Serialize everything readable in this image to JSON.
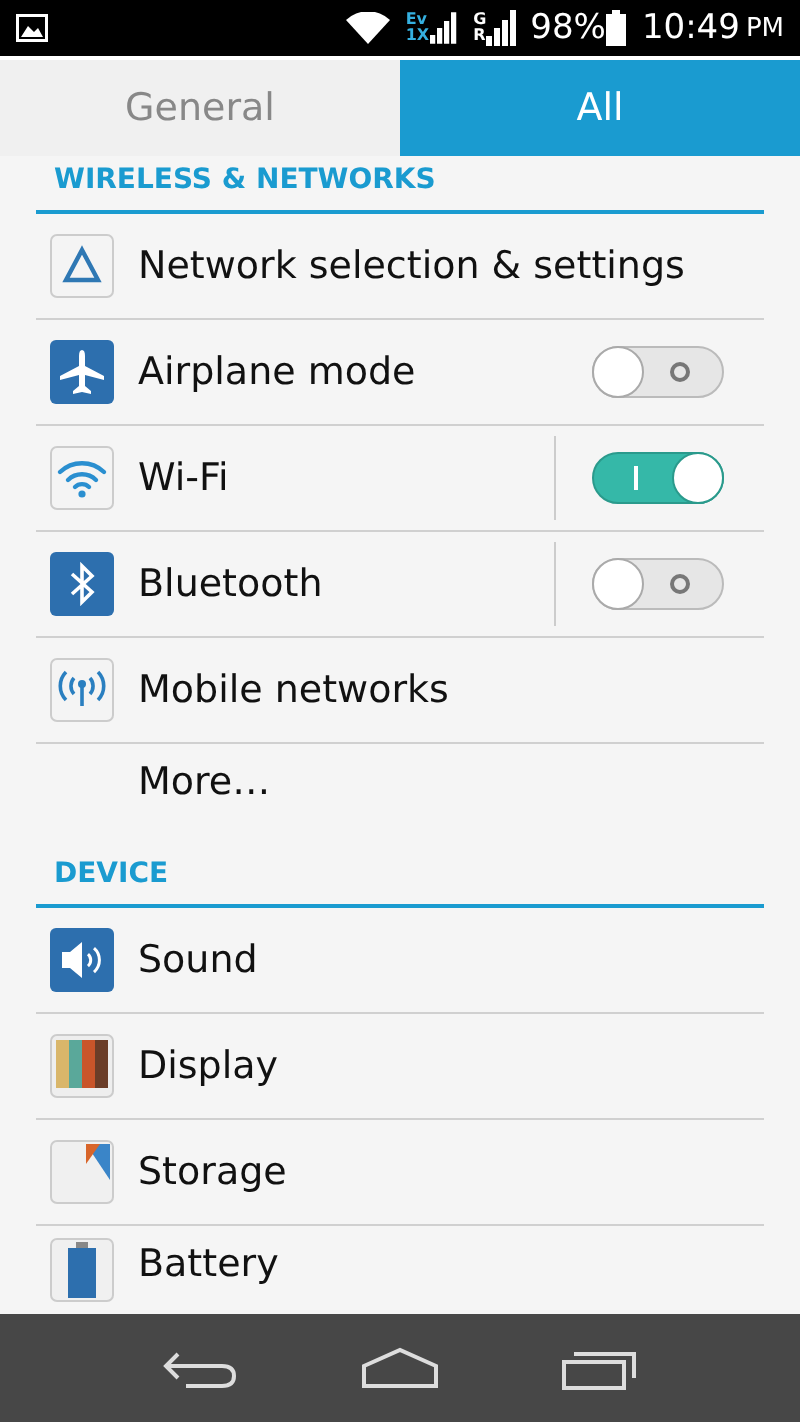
{
  "status_bar": {
    "data_labels": [
      {
        "top": "Ev",
        "bottom": "1X"
      },
      {
        "top": "G",
        "bottom": "R"
      }
    ],
    "battery": "98%",
    "time": "10:49",
    "meridiem": "PM"
  },
  "tabs": [
    {
      "label": "General",
      "selected": false
    },
    {
      "label": "All",
      "selected": true
    }
  ],
  "sections": [
    {
      "title": "WIRELESS & NETWORKS",
      "items": [
        {
          "label": "Network selection & settings",
          "kind": "plain"
        },
        {
          "label": "Airplane mode",
          "kind": "toggle",
          "on": false
        },
        {
          "label": "Wi-Fi",
          "kind": "split-toggle",
          "on": true
        },
        {
          "label": "Bluetooth",
          "kind": "split-toggle",
          "on": false
        },
        {
          "label": "Mobile networks",
          "kind": "plain"
        },
        {
          "label": "More…",
          "kind": "plain"
        }
      ]
    },
    {
      "title": "DEVICE",
      "items": [
        {
          "label": "Sound",
          "kind": "plain"
        },
        {
          "label": "Display",
          "kind": "plain"
        },
        {
          "label": "Storage",
          "kind": "plain"
        },
        {
          "label": "Battery",
          "kind": "plain"
        }
      ]
    }
  ]
}
